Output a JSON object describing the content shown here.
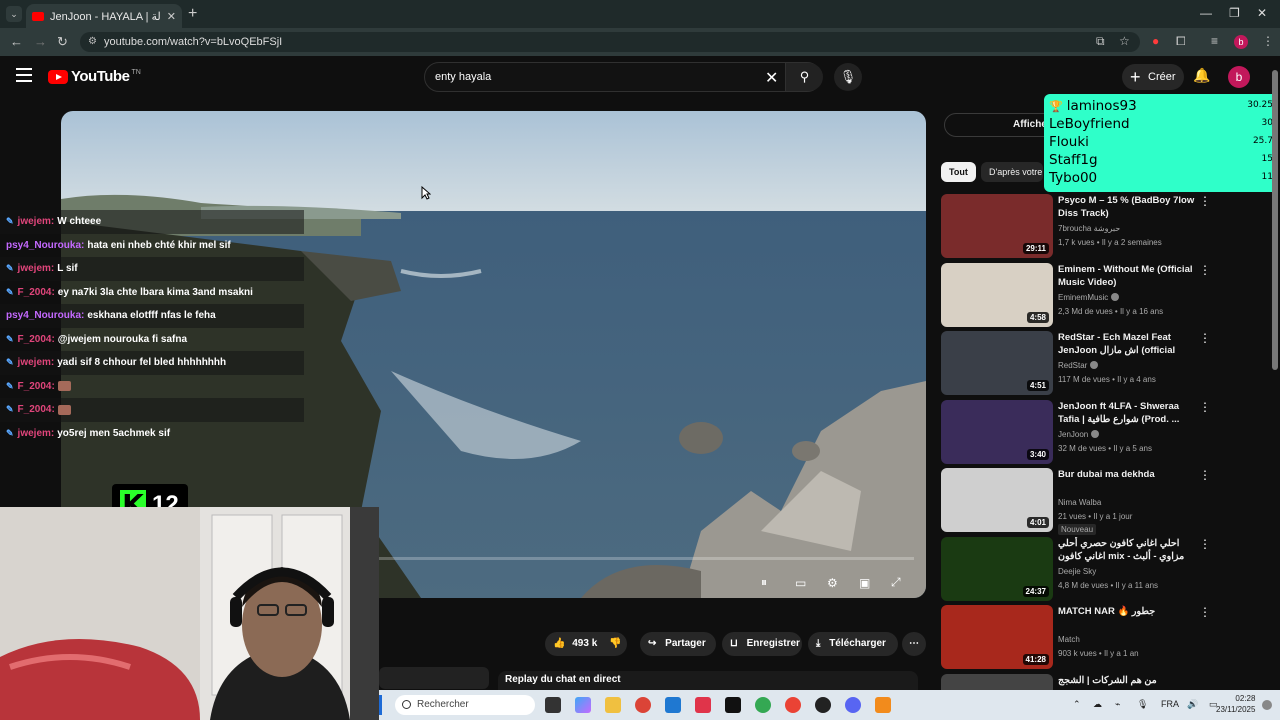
{
  "browser": {
    "tab_title": "JenJoon - HAYALA | حيالة (O...",
    "address": "youtube.com/watch?v=bLvoQEbFSjI"
  },
  "youtube": {
    "logo_text": "YouTube",
    "logo_suffix": "TN",
    "search_query": "enty hayala",
    "create_label": "Créer",
    "avatar_letter": "b"
  },
  "chat": [
    {
      "user": "jwejem:",
      "msg": "W chteee",
      "pinned": true,
      "color": "#e0457b"
    },
    {
      "user": "psy4_Nourouka:",
      "msg": "hata eni nheb chté khir mel sif",
      "pinned": false,
      "color": "#c469ff"
    },
    {
      "user": "jwejem:",
      "msg": "L sif",
      "pinned": true,
      "color": "#e0457b"
    },
    {
      "user": "F_2004:",
      "msg": "ey na7ki 3la chte lbara kima 3and msakni",
      "pinned": true,
      "color": "#e0457b"
    },
    {
      "user": "psy4_Nourouka:",
      "msg": "eskhana elotfff nfas le feha",
      "pinned": false,
      "color": "#c469ff"
    },
    {
      "user": "F_2004:",
      "msg": "@jwejem nourouka fi safna",
      "pinned": true,
      "color": "#e0457b"
    },
    {
      "user": "jwejem:",
      "msg": "yadi sif 8 chhour fel bled hhhhhhhh",
      "pinned": true,
      "color": "#e0457b"
    },
    {
      "user": "F_2004:",
      "msg": "",
      "pinned": true,
      "color": "#e0457b",
      "emoji": true
    },
    {
      "user": "F_2004:",
      "msg": "",
      "pinned": true,
      "color": "#e0457b",
      "emoji": true
    },
    {
      "user": "jwejem:",
      "msg": "yo5rej men 5achmek sif",
      "pinned": true,
      "color": "#e0457b"
    }
  ],
  "counter": {
    "letter": "K",
    "value": "12"
  },
  "actions": {
    "likes": "493 k",
    "share": "Partager",
    "save": "Enregistrer",
    "download": "Télécharger"
  },
  "live_chat_replay": "Replay du chat en direct",
  "sidebar": {
    "show_label": "Afficher",
    "chips": [
      "Tout",
      "D'après votre"
    ],
    "videos": [
      {
        "title": "Psyco M – 15 % (BadBoy 7low Diss Track)",
        "channel": "7broucha حبروشة",
        "meta": "1,7 k vues • Il y a 2 semaines",
        "duration": "29:11",
        "verified": false
      },
      {
        "title": "Eminem - Without Me (Official Music Video)",
        "channel": "EminemMusic",
        "meta": "2,3 Md de vues • Il y a 16 ans",
        "duration": "4:58",
        "verified": true
      },
      {
        "title": "RedStar - Ech Mazel Feat JenJoon اش مازال (official video)",
        "channel": "RedStar",
        "meta": "117 M de vues • Il y a 4 ans",
        "duration": "4:51",
        "verified": true
      },
      {
        "title": "JenJoon ft 4LFA - Shweraa Tafia | شوارع طافية (Prod. ...",
        "channel": "JenJoon",
        "meta": "32 M de vues • Il y a 5 ans",
        "duration": "3:40",
        "verified": true
      },
      {
        "title": "Bur dubai ma dekhda",
        "channel": "Nima Walba",
        "meta": "21 vues • Il y a 1 jour",
        "duration": "4:01",
        "verified": false,
        "badge": "Nouveau"
      },
      {
        "title": "احلي اغاني كافون حصري أحلي اغاني كافون mix - مزاوي - ألبث ماسكا في ميكس مهبول",
        "channel": "Deejie Sky",
        "meta": "4,8 M de vues • Il y a 11 ans",
        "duration": "24:37",
        "verified": false
      },
      {
        "title": "MATCH NAR 🔥 جطور",
        "channel": "Match",
        "meta": "903 k vues • Il y a 1 an",
        "duration": "41:28",
        "verified": false
      },
      {
        "title": "من هم الشركات | الشجج",
        "channel": "",
        "meta": "",
        "duration": "",
        "verified": false
      }
    ]
  },
  "leaderboard": [
    {
      "name": "laminos93",
      "score": "30.25",
      "trophy": true
    },
    {
      "name": "LeBoyfriend",
      "score": "30"
    },
    {
      "name": "Flouki",
      "score": "25.7"
    },
    {
      "name": "Staff1g",
      "score": "15"
    },
    {
      "name": "Tybo00",
      "score": "11"
    }
  ],
  "taskbar": {
    "search_placeholder": "Rechercher",
    "lang": "FRA",
    "time": "02:28",
    "date": "23/11/2025"
  }
}
